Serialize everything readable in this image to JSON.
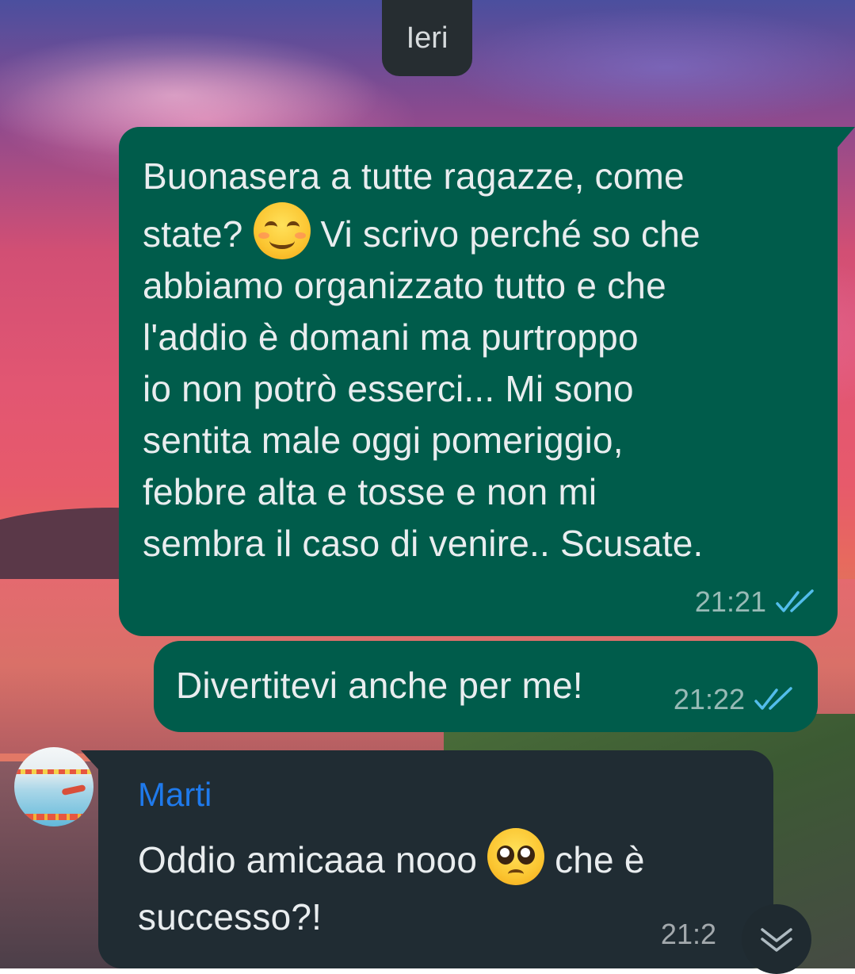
{
  "date_separator": "Ieri",
  "messages": [
    {
      "direction": "outgoing",
      "text_before_emoji": "Buonasera a tutte ragazze, come\nstate? ",
      "emoji": "smiling-face-with-smiling-eyes",
      "text_after_emoji": " Vi scrivo perché so che\nabbiamo organizzato tutto e che\nl'addio è domani ma purtroppo\nio non potrò esserci... Mi sono\nsentita male oggi pomeriggio,\nfebbre alta e tosse e non mi\nsembra il caso di venire.. Scusate.",
      "time": "21:21",
      "status": "read"
    },
    {
      "direction": "outgoing",
      "text": "Divertitevi anche per me!",
      "time": "21:22",
      "status": "read"
    },
    {
      "direction": "incoming",
      "sender": "Marti",
      "text_before_emoji": "Oddio amicaaa nooo ",
      "emoji": "pleading-face",
      "text_after_emoji": " che è\nsuccesso?!",
      "time": "21:2"
    }
  ],
  "colors": {
    "outgoing_bubble": "#005c4b",
    "incoming_bubble": "#202c33",
    "read_ticks": "#53bdeb",
    "sender_name": "#1f7aec"
  },
  "icons": {
    "read_receipt": "double-check-icon",
    "scroll_down": "chevron-double-down-icon"
  }
}
